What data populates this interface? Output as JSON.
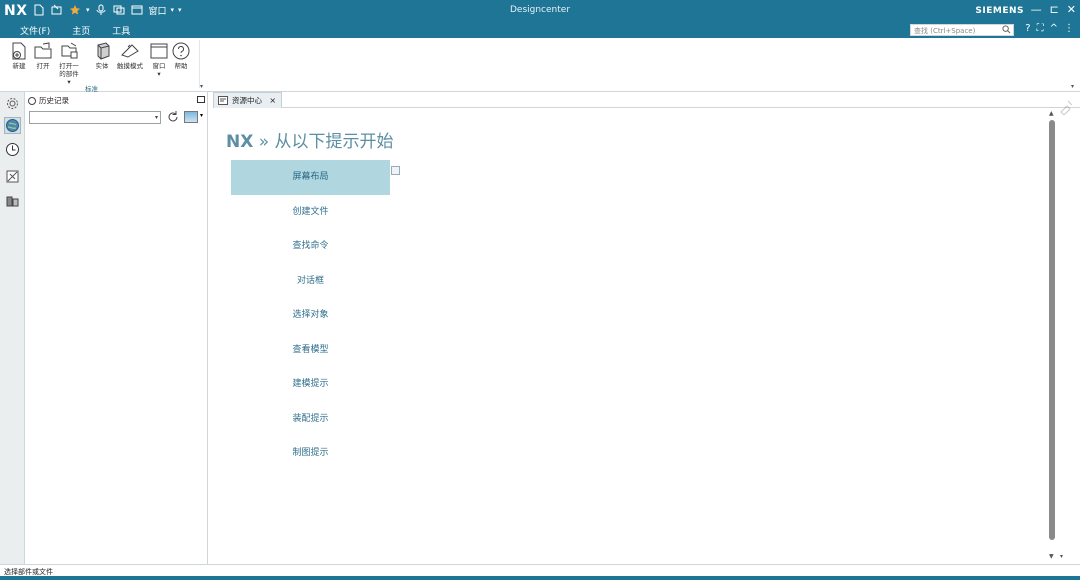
{
  "window": {
    "logo": "NX",
    "title": "Designcenter",
    "brand": "SIEMENS",
    "qat_window_label": "窗口",
    "controls": [
      "—",
      "⊏",
      "✕"
    ]
  },
  "menu": {
    "tabs": [
      {
        "label": "文件(F)",
        "active": false
      },
      {
        "label": "主页",
        "active": true
      },
      {
        "label": "工具",
        "active": false
      }
    ],
    "command_finder_placeholder": "查找 (Ctrl+Space)"
  },
  "ribbon": {
    "buttons": [
      {
        "label": "新建",
        "icon": "new-file-icon"
      },
      {
        "label": "打开",
        "icon": "open-folder-icon"
      },
      {
        "label": "打开一\n的部件",
        "icon": "open-part-icon"
      },
      {
        "label": "实体",
        "icon": "solid-icon"
      },
      {
        "label": "触摸模式",
        "icon": "touch-mode-icon"
      },
      {
        "label": "窗口",
        "icon": "window-icon"
      },
      {
        "label": "帮助",
        "icon": "help-icon"
      }
    ],
    "group_label": "标准"
  },
  "history_panel": {
    "title": "历史记录"
  },
  "document_tab": {
    "label": "资源中心",
    "close": "×"
  },
  "content": {
    "heading_nx": "NX",
    "heading_rest": " » 从以下提示开始",
    "nav_items": [
      {
        "label": "屏幕布局",
        "selected": true
      },
      {
        "label": "创建文件",
        "selected": false
      },
      {
        "label": "查找命令",
        "selected": false
      },
      {
        "label": "对话框",
        "selected": false
      },
      {
        "label": "选择对象",
        "selected": false
      },
      {
        "label": "查看模型",
        "selected": false
      },
      {
        "label": "建模提示",
        "selected": false
      },
      {
        "label": "装配提示",
        "selected": false
      },
      {
        "label": "制图提示",
        "selected": false
      }
    ]
  },
  "status": {
    "text": "选择部件或文件"
  },
  "colors": {
    "titlebar": "#1f7596",
    "accent_tab": "#f2a93b",
    "nav_selected_bg": "#b0d7e0",
    "nav_text": "#2f6f8c",
    "heading": "#5c8fa3"
  }
}
